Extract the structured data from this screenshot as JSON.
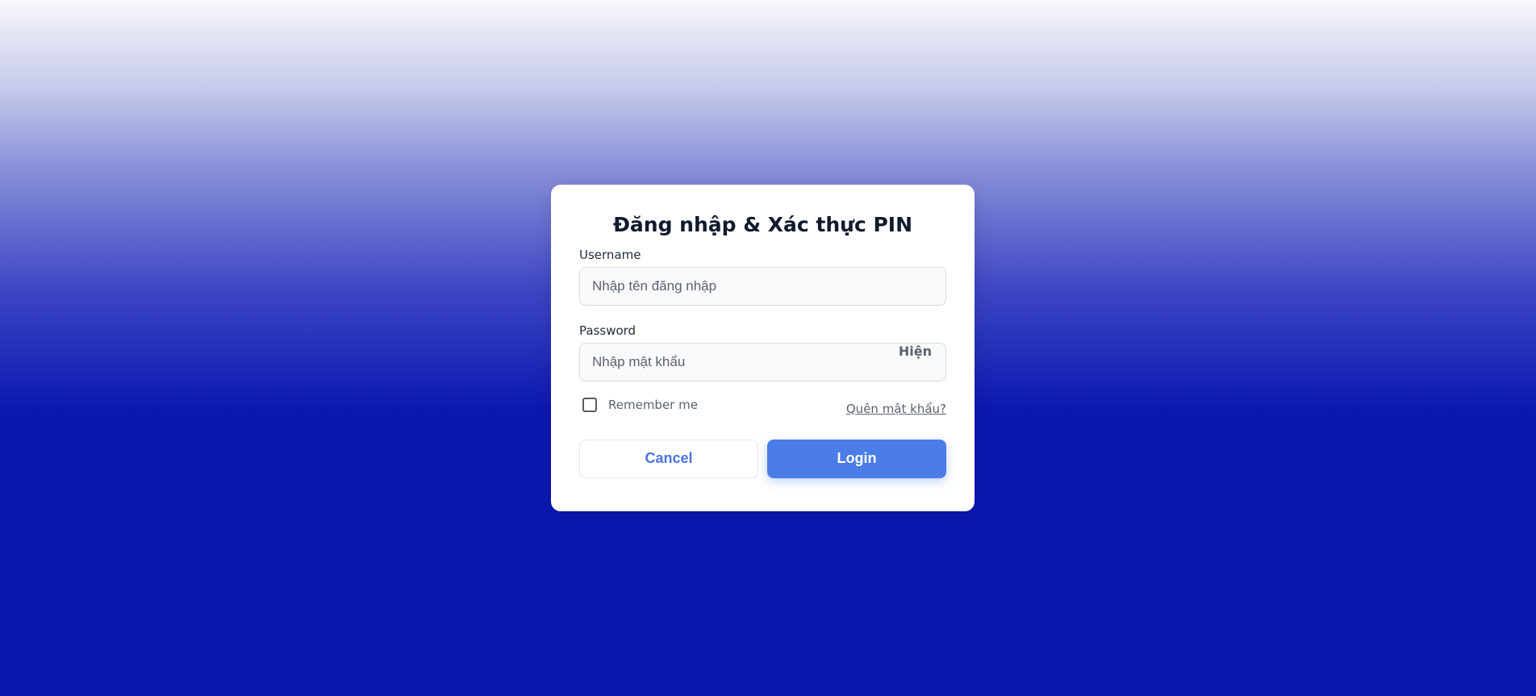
{
  "login_form": {
    "title": "Đăng nhập & Xác thực PIN",
    "username": {
      "label": "Username",
      "placeholder": "Nhập tên đăng nhập",
      "value": ""
    },
    "password": {
      "label": "Password",
      "placeholder": "Nhập mật khẩu",
      "value": "",
      "toggle_label": "Hiện"
    },
    "remember_me": {
      "label": "Remember me",
      "checked": false
    },
    "forgot_password_label": "Quên mật khẩu?",
    "cancel_label": "Cancel",
    "login_label": "Login"
  },
  "colors": {
    "primary": "#4a7de8",
    "background_bottom": "#0c17b1",
    "card": "#ffffff",
    "muted_text": "#5b6370"
  }
}
